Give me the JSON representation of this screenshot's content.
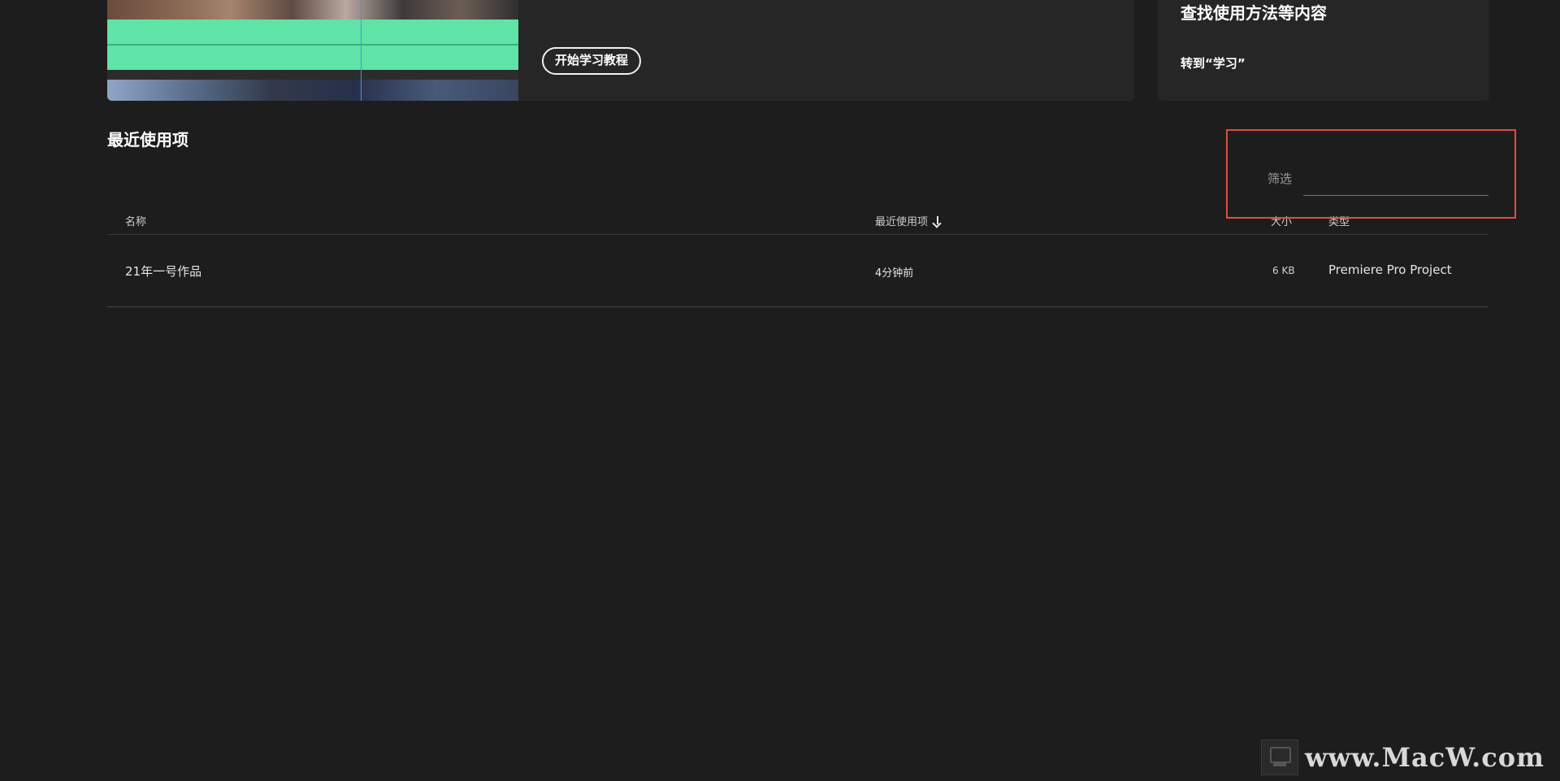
{
  "tutorial": {
    "start_button_label": "开始学习教程"
  },
  "learn": {
    "title": "查找使用方法等内容",
    "link_label": "转到“学习”"
  },
  "recent": {
    "title": "最近使用项",
    "filter": {
      "label": "筛选",
      "value": "",
      "placeholder": ""
    },
    "columns": {
      "name": "名称",
      "recent": "最近使用项",
      "size": "大小",
      "type": "类型"
    },
    "rows": [
      {
        "name": "21年一号作品",
        "recent": "4分钟前",
        "size": "6 KB",
        "type": "Premiere Pro Project"
      }
    ]
  },
  "watermark": {
    "text": "www.MacW.com"
  },
  "colors": {
    "background": "#1d1d1d",
    "card": "#262626",
    "accent_blue": "#3d7bf2",
    "highlight_red": "#e34b41",
    "audio_green": "#5fe3a6"
  }
}
